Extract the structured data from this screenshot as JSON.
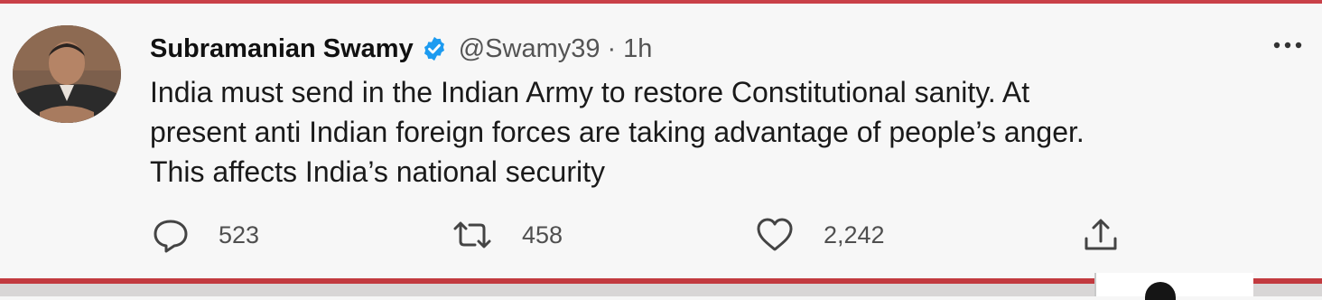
{
  "tweet": {
    "author": {
      "display_name": "Subramanian Swamy",
      "handle": "@Swamy39",
      "verified": true,
      "avatar_icon": "profile-photo"
    },
    "separator": "·",
    "time": "1h",
    "more_icon": "ellipsis-icon",
    "text_lines": [
      "India must send in the Indian Army to restore Constitutional sanity. At",
      "present anti Indian foreign forces are taking advantage of people’s anger.",
      "This affects India’s national security"
    ],
    "actions": {
      "reply": {
        "icon": "reply-icon",
        "count": "523"
      },
      "retweet": {
        "icon": "retweet-icon",
        "count": "458"
      },
      "like": {
        "icon": "heart-icon",
        "count": "2,242"
      },
      "share": {
        "icon": "share-icon"
      }
    }
  },
  "colors": {
    "verified_badge": "#1d9bf0",
    "accent_red": "#c23a3f",
    "text_primary": "#111111",
    "text_secondary": "#545454"
  }
}
